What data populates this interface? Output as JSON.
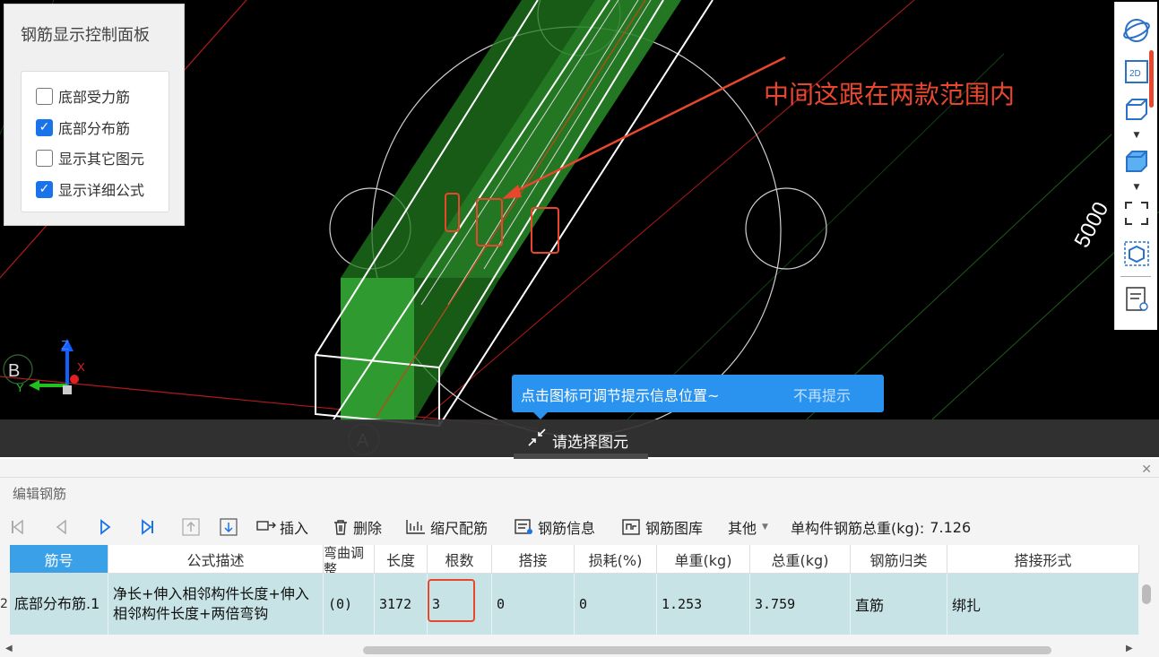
{
  "viewport": {
    "control_panel": {
      "title": "钢筋显示控制面板",
      "options": [
        {
          "label": "底部受力筋",
          "checked": false
        },
        {
          "label": "底部分布筋",
          "checked": true
        },
        {
          "label": "显示其它图元",
          "checked": false
        },
        {
          "label": "显示详细公式",
          "checked": true
        }
      ]
    },
    "annotation_text": "中间这跟在两款范围内",
    "dimension_label": "5000",
    "axis_labels": {
      "grid_b": "B",
      "grid_a": "A",
      "z": "Z",
      "x": "X",
      "y": "Y"
    },
    "tip": {
      "text": "点击图标可调节提示信息位置~",
      "dismiss": "不再提示"
    },
    "status_text": "请选择图元",
    "right_toolbar": [
      "orbit-icon",
      "view-2d-icon",
      "view-3d-box-icon",
      "solid-box-icon",
      "fullscreen-icon",
      "display-box-icon",
      "properties-icon"
    ],
    "accent_color": "#e8472e",
    "tip_color": "#2a93ef"
  },
  "bottom_panel": {
    "title": "编辑钢筋",
    "toolbar": {
      "insert": "插入",
      "delete": "删除",
      "scale_rebar": "缩尺配筋",
      "rebar_info": "钢筋信息",
      "rebar_library": "钢筋图库",
      "other": "其他",
      "total_weight_label": "单构件钢筋总重(kg):",
      "total_weight_value": "7.126"
    },
    "columns": [
      "筋号",
      "公式描述",
      "弯曲调整",
      "长度",
      "根数",
      "搭接",
      "损耗(%)",
      "单重(kg)",
      "总重(kg)",
      "钢筋归类",
      "搭接形式"
    ],
    "row_number": "2",
    "row": {
      "name": "底部分布筋.1",
      "formula": "净长+伸入相邻构件长度+伸入相邻构件长度+两倍弯钩",
      "bend": "(0)",
      "length": "3172",
      "count": "3",
      "lap": "0",
      "loss": "0",
      "unit_weight": "1.253",
      "total_weight": "3.759",
      "category": "直筋",
      "lap_type": "绑扎"
    }
  }
}
